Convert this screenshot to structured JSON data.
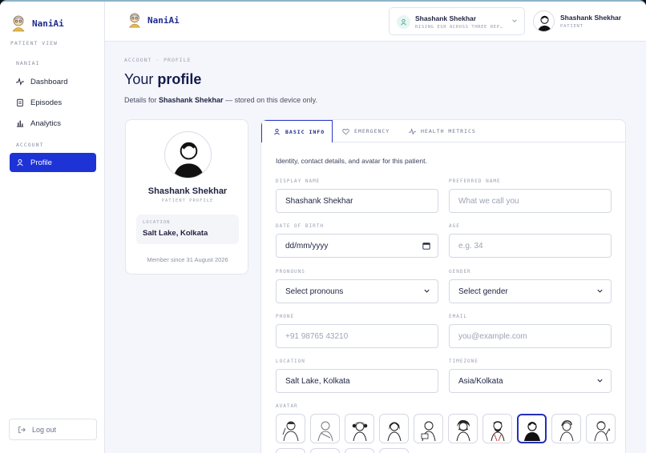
{
  "app": {
    "name": "NaniAi"
  },
  "sidebar": {
    "section_patient": "PATIENT VIEW",
    "section_naniai": "NANIAI",
    "items": [
      {
        "label": "Dashboard",
        "icon": "activity-icon"
      },
      {
        "label": "Episodes",
        "icon": "clipboard-icon"
      },
      {
        "label": "Analytics",
        "icon": "bar-chart-icon"
      }
    ],
    "section_account": "ACCOUNT",
    "profile_label": "Profile",
    "logout_label": "Log out"
  },
  "topbar": {
    "patient_name": "Shashank Shekhar",
    "patient_sub": "RISING ESR ACROSS THREE REP…",
    "user_name": "Shashank Shekhar",
    "user_role": "PATIENT"
  },
  "page": {
    "breadcrumb": "ACCOUNT · PROFILE",
    "title_prefix": "Your ",
    "title_bold": "profile",
    "subtitle_prefix": "Details for ",
    "subtitle_name": "Shashank Shekhar",
    "subtitle_suffix": " — stored on this device only."
  },
  "profile_card": {
    "name": "Shashank Shekhar",
    "role": "PATIENT PROFILE",
    "location_label": "LOCATION",
    "location_value": "Salt Lake, Kolkata",
    "member_since": "Member since 31 August 2026"
  },
  "tabs": [
    {
      "label": "BASIC INFO",
      "icon": "user-icon",
      "active": true
    },
    {
      "label": "EMERGENCY",
      "icon": "heart-icon",
      "active": false
    },
    {
      "label": "HEALTH METRICS",
      "icon": "activity-icon",
      "active": false
    }
  ],
  "form": {
    "intro": "Identity, contact details, and avatar for this patient.",
    "display_name": {
      "label": "DISPLAY NAME",
      "value": "Shashank Shekhar"
    },
    "preferred_name": {
      "label": "PREFERRED NAME",
      "placeholder": "What we call you"
    },
    "dob": {
      "label": "DATE OF BIRTH",
      "value": "dd/mm/yyyy"
    },
    "age": {
      "label": "AGE",
      "placeholder": "e.g. 34"
    },
    "pronouns": {
      "label": "PRONOUNS",
      "value": "Select pronouns"
    },
    "gender": {
      "label": "GENDER",
      "value": "Select gender"
    },
    "phone": {
      "label": "PHONE",
      "placeholder": "+91 98765 43210"
    },
    "email": {
      "label": "EMAIL",
      "placeholder": "you@example.com"
    },
    "location": {
      "label": "LOCATION",
      "value": "Salt Lake, Kolkata"
    },
    "timezone": {
      "label": "TIMEZONE",
      "value": "Asia/Kolkata"
    },
    "avatar_label": "AVATAR",
    "avatar_selected_index": 7
  },
  "colors": {
    "accent": "#1d33d6",
    "brand_text": "#1d2a8f"
  }
}
